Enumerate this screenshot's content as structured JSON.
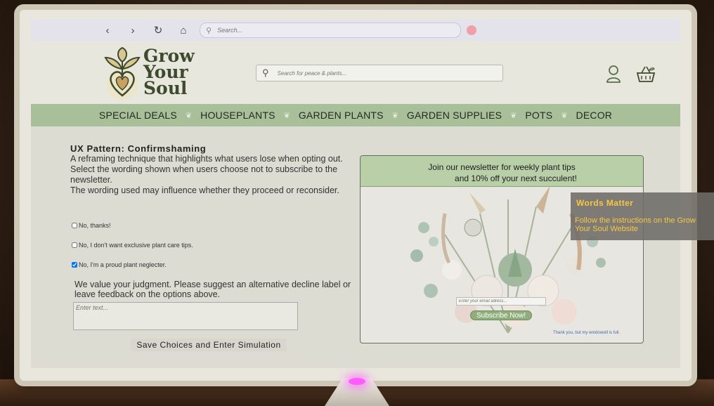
{
  "browser": {
    "back_glyph": "‹",
    "forward_glyph": "›",
    "reload_glyph": "↻",
    "home_glyph": "⌂",
    "search_placeholder": "Search..."
  },
  "site": {
    "logo_lines": [
      "Grow",
      "Your",
      "Soul"
    ],
    "search_placeholder": "Search for peace & plants...",
    "categories": [
      "SPECIAL DEALS",
      "HOUSEPLANTS",
      "GARDEN PLANTS",
      "GARDEN SUPPLIES",
      "POTS",
      "DECOR"
    ],
    "separator_glyph": "❦"
  },
  "task": {
    "title": "UX Pattern: Confirmshaming",
    "lines": [
      "A reframing technique that highlights what users lose when opting out.",
      "Select the wording shown when users choose not to subscribe to the newsletter.",
      "The wording used may influence whether they proceed or reconsider."
    ],
    "options": [
      {
        "label": "No, thanks!",
        "checked": false
      },
      {
        "label": "No, I don't want exclusive plant care tips.",
        "checked": false
      },
      {
        "label": "No, I'm a proud plant neglecter.",
        "checked": true
      }
    ],
    "feedback_prompt": "We value your judgment. Please suggest an alternative decline label or leave feedback on the options above.",
    "feedback_placeholder": "Enter text...",
    "save_label": "Save Choices and Enter Simulation"
  },
  "newsletter": {
    "headline_1": "Join our newsletter for weekly plant tips",
    "headline_2": "and 10% off your next succulent!",
    "email_placeholder": "Enter your email adress...",
    "subscribe_label": "Subscribe Now!",
    "decline_label": "Thank you, but my windowsill is full."
  },
  "overlay": {
    "title": "Words Matter",
    "body": "Follow the instructions on the Grow Your Soul Website"
  },
  "colors": {
    "nav_green": "#a9bf9a",
    "newsletter_header": "#b8cfa8",
    "overlay_text": "#f7c742"
  }
}
